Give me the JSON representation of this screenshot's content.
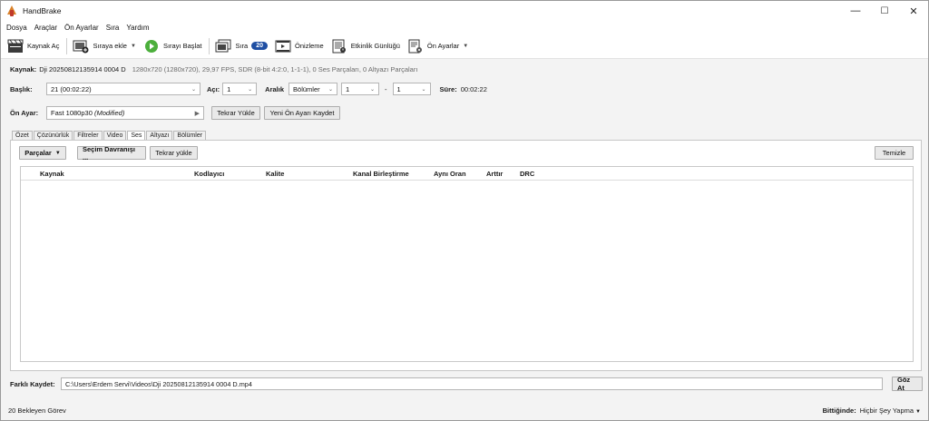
{
  "window": {
    "title": "HandBrake",
    "controls": {
      "minimize": "—",
      "maximize": "☐",
      "close": "✕"
    }
  },
  "menu": [
    "Dosya",
    "Araçlar",
    "Ön Ayarlar",
    "Sıra",
    "Yardım"
  ],
  "toolbar": {
    "open_source": "Kaynak Aç",
    "add_to_queue": "Sıraya ekle",
    "start_queue": "Sırayı Başlat",
    "queue": "Sıra",
    "queue_count": "20",
    "preview": "Önizleme",
    "activity_log": "Etkinlik Günlüğü",
    "presets": "Ön Ayarlar"
  },
  "source": {
    "label": "Kaynak:",
    "name": "Dji 20250812135914 0004 D",
    "info": "1280x720 (1280x720), 29,97 FPS, SDR (8-bit 4:2:0, 1-1-1), 0 Ses Parçaları, 0 Altyazı Parçaları"
  },
  "title_row": {
    "title_label": "Başlık:",
    "title_value": "21 (00:02:22)",
    "angle_label": "Açı:",
    "angle_value": "1",
    "range_label": "Aralık",
    "range_type": "Bölümler",
    "range_start": "1",
    "range_dash": "-",
    "range_end": "1",
    "duration_label": "Süre:",
    "duration_value": "00:02:22"
  },
  "preset_row": {
    "label": "Ön Ayar:",
    "value": "Fast 1080p30",
    "modified": "(Modified)",
    "reload": "Tekrar Yükle",
    "save_new": "Yeni Ön Ayarı Kaydet"
  },
  "tabs": [
    "Özet",
    "Çözünürlük",
    "Filtreler",
    "Video",
    "Ses",
    "Altyazı",
    "Bölümler"
  ],
  "audio": {
    "tracks_button": "Parçalar",
    "selection_behavior": "Seçim Davranışı ...",
    "reload": "Tekrar yükle",
    "clear": "Temizle",
    "columns": [
      "Kaynak",
      "Kodlayıcı",
      "Kalite",
      "Kanal Birleştirme",
      "Aynı Oran",
      "Arttır",
      "DRC"
    ]
  },
  "save_as": {
    "label": "Farklı Kaydet:",
    "path": "C:\\Users\\Erdem Servi\\Videos\\Dji 20250812135914 0004 D.mp4",
    "browse": "Göz At"
  },
  "status": {
    "pending": "20 Bekleyen Görev",
    "when_done_label": "Bittiğinde:",
    "when_done_value": "Hiçbir Şey Yapma"
  }
}
